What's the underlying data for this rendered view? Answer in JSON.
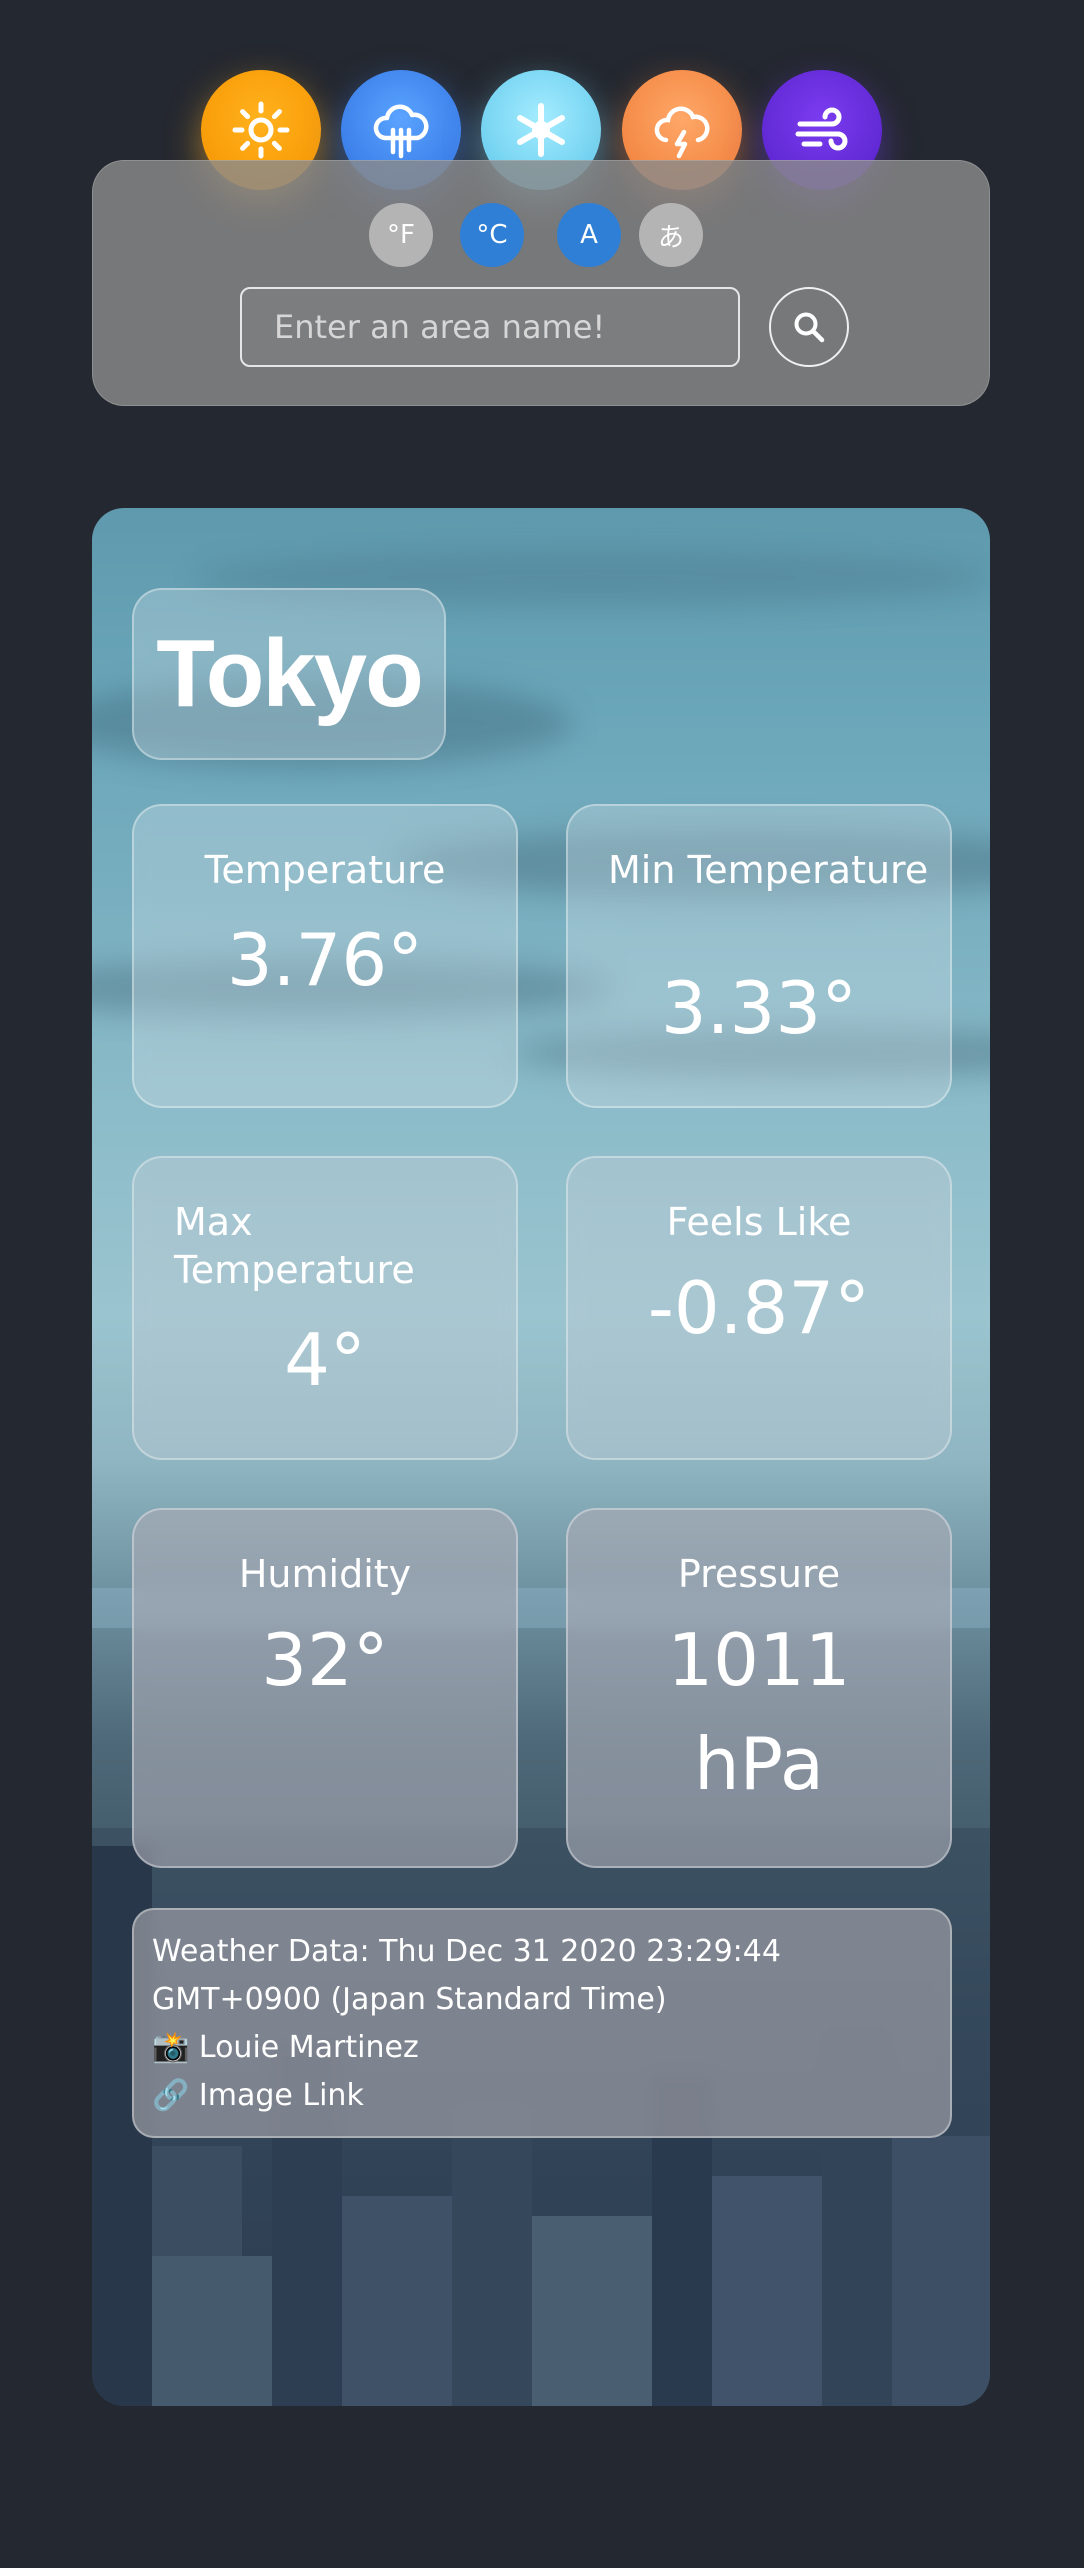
{
  "weather_icons": [
    {
      "name": "sun-icon",
      "color": "#f59e00"
    },
    {
      "name": "rain-cloud-icon",
      "color": "#3b7fe8"
    },
    {
      "name": "snowflake-icon",
      "color": "#7fd8f2"
    },
    {
      "name": "thunder-cloud-icon",
      "color": "#f0843e"
    },
    {
      "name": "wind-icon",
      "color": "#6430dc"
    }
  ],
  "controls": {
    "units": [
      {
        "label": "°F",
        "active": false
      },
      {
        "label": "°C",
        "active": true
      }
    ],
    "languages": [
      {
        "label": "A",
        "active": true
      },
      {
        "label": "あ",
        "active": false
      }
    ],
    "search": {
      "placeholder": "Enter an area name!",
      "value": "",
      "button_icon": "search-icon"
    }
  },
  "weather": {
    "city": "Tokyo",
    "temperature": {
      "label": "Temperature",
      "value": "3.76°"
    },
    "min_temperature": {
      "label": "Min Temperature",
      "value": "3.33°"
    },
    "max_temperature": {
      "label": "Max Temperature",
      "value": "4°"
    },
    "feels_like": {
      "label": "Feels Like",
      "value": "-0.87°"
    },
    "humidity": {
      "label": "Humidity",
      "value": "32°"
    },
    "pressure": {
      "label": "Pressure",
      "value": "1011",
      "unit": "hPa"
    }
  },
  "footer": {
    "data_time_line1": "Weather Data: Thu Dec 31 2020 23:29:44",
    "data_time_line2": "GMT+0900 (Japan Standard Time)",
    "photographer": "📸 Louie Martinez",
    "image_link": "🔗 Image Link"
  },
  "colors": {
    "page_bg": "#242830",
    "accent_active": "#2f7fd6",
    "inactive_button": "#b4b4b4"
  }
}
